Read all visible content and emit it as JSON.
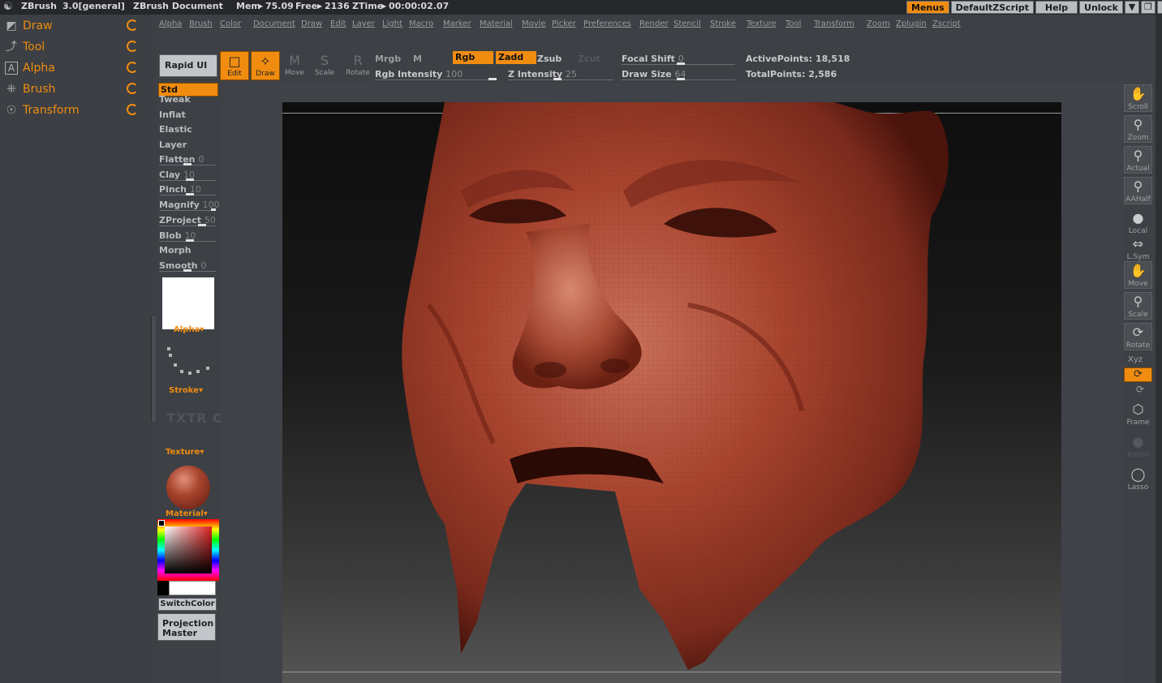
{
  "titlebar": {
    "app": "ZBrush",
    "version": "3.0[general]",
    "document": "ZBrush Document",
    "mem_label": "Mem",
    "mem_value": "75.09",
    "free_label": "Free",
    "free_value": "2136",
    "ztime_label": "ZTime",
    "ztime_value": "00:00:02.07",
    "buttons": [
      "Menus",
      "DefaultZScript",
      "Help",
      "Unlock"
    ],
    "window_controls": [
      "minimize",
      "restore",
      "close"
    ]
  },
  "palettes": [
    {
      "label": "Draw",
      "icon": "draw-icon"
    },
    {
      "label": "Tool",
      "icon": "tool-icon"
    },
    {
      "label": "Alpha",
      "icon": "alpha-icon"
    },
    {
      "label": "Brush",
      "icon": "brush-icon"
    },
    {
      "label": "Transform",
      "icon": "transform-icon"
    }
  ],
  "menus": [
    "Alpha",
    "Brush",
    "Color",
    "Document",
    "Draw",
    "Edit",
    "Layer",
    "Light",
    "Macro",
    "Marker",
    "Material",
    "Movie",
    "Picker",
    "Preferences",
    "Render",
    "Stencil",
    "Stroke",
    "Texture",
    "Tool",
    "Transform",
    "Zoom",
    "Zplugin",
    "Zscript"
  ],
  "shelf": {
    "rapid_ui": "Rapid UI",
    "tools": [
      {
        "label": "Edit",
        "active": true
      },
      {
        "label": "Draw",
        "active": true
      },
      {
        "label": "Move",
        "active": false
      },
      {
        "label": "Scale",
        "active": false
      },
      {
        "label": "Rotate",
        "active": false
      }
    ],
    "mrgb": "Mrgb",
    "m": "M",
    "rgb": "Rgb",
    "zadd": "Zadd",
    "zsub": "Zsub",
    "zcut": "Zcut",
    "rgb_intensity_label": "Rgb  Intensity",
    "rgb_intensity_value": "100",
    "z_intensity_label": "Z  Intensity",
    "z_intensity_value": "25",
    "focal_shift_label": "Focal  Shift",
    "focal_shift_value": "0",
    "draw_size_label": "Draw  Size",
    "draw_size_value": "64",
    "active_points": "ActivePoints: 18,518",
    "total_points": "TotalPoints: 2,586"
  },
  "brushes": {
    "selected": "Std",
    "items": [
      {
        "label": "Tweak",
        "value": ""
      },
      {
        "label": "Inflat",
        "value": ""
      },
      {
        "label": "Elastic",
        "value": ""
      },
      {
        "label": "Layer",
        "value": ""
      },
      {
        "label": "Flatten",
        "value": "0"
      },
      {
        "label": "Clay",
        "value": "10"
      },
      {
        "label": "Pinch",
        "value": "10"
      },
      {
        "label": "Magnify",
        "value": "100"
      },
      {
        "label": "ZProject",
        "value": "50"
      },
      {
        "label": "Blob",
        "value": "10"
      },
      {
        "label": "Morph",
        "value": ""
      },
      {
        "label": "Smooth",
        "value": "0"
      }
    ],
    "alpha_label": "Alpha",
    "stroke_label": "Stroke",
    "texture_placeholder": "TXTR OFF",
    "texture_label": "Texture",
    "material_label": "Material",
    "switch_color": "SwitchColor",
    "projection_master": "Projection Master"
  },
  "right_tray": [
    {
      "label": "Scroll",
      "icon": "scroll-hand-icon"
    },
    {
      "label": "Zoom",
      "icon": "zoom-icon"
    },
    {
      "label": "Actual",
      "icon": "actual-size-icon"
    },
    {
      "label": "AAHalf",
      "icon": "aahalf-icon"
    },
    {
      "label": "Local",
      "icon": "local-icon"
    },
    {
      "label": "L.Sym",
      "icon": "local-symmetry-icon"
    },
    {
      "label": "Move",
      "icon": "move-hand-icon"
    },
    {
      "label": "Scale",
      "icon": "scale-icon"
    },
    {
      "label": "Rotate",
      "icon": "rotate-icon"
    },
    {
      "label": "Frame",
      "icon": "frame-icon"
    },
    {
      "label": "Xpose",
      "icon": "xpose-icon"
    },
    {
      "label": "Lasso",
      "icon": "lasso-icon"
    }
  ],
  "rotate_axis": {
    "xyz": "Xyz"
  },
  "colors": {
    "accent": "#f08c10",
    "model": "#a8442e",
    "panel": "#3d4045"
  }
}
